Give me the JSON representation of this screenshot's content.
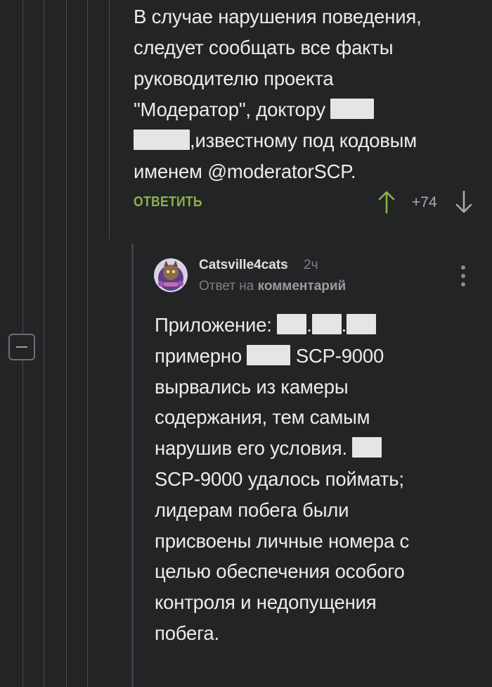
{
  "parent_comment": {
    "lines": [
      "В случае нарушения поведения,",
      "следует сообщать все факты",
      "руководителю проекта",
      "\"Модератор\", доктору",
      ",известному под кодовым",
      "именем @moderatorSCP."
    ],
    "reply_label": "ОТВЕТИТЬ",
    "score": "+74"
  },
  "reply_comment": {
    "author": "Catsville4cats",
    "time": "2ч",
    "reply_prefix": "Ответ на",
    "reply_target": "комментарий",
    "text": {
      "l1_prefix": "Приложение: ",
      "l2_prefix": "примерно ",
      "l2_suffix": " SCP-9000",
      "l3": "вырвались из камеры",
      "l4": "содержания, тем самым",
      "l5_prefix": "нарушив его условия. ",
      "l6": "SCP-9000 удалось поймать;",
      "l7": "лидерам побега были",
      "l8": "присвоены личные номера с",
      "l9": "целью обеспечения особого",
      "l10": "контроля и недопущения",
      "l11": "побега."
    }
  },
  "colors": {
    "background": "#222426",
    "accent_green": "#8ab14a",
    "text": "#ececec",
    "muted": "#7d7f82"
  },
  "icons": {
    "upvote": "arrow-up-icon",
    "downvote": "arrow-down-icon",
    "more": "more-vertical-icon",
    "collapse": "minus-icon"
  }
}
